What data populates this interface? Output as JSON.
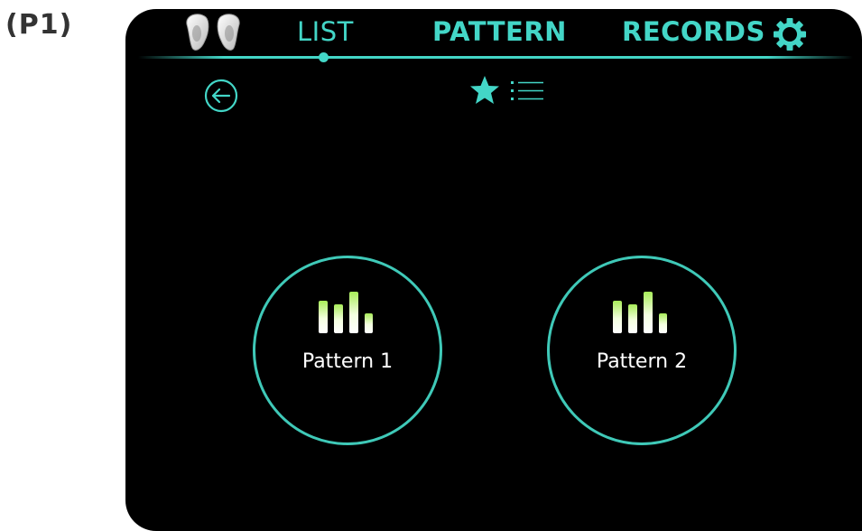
{
  "figure_label": "(P1)",
  "nav": {
    "items": [
      {
        "label": "LIST"
      },
      {
        "label": "PATTERN"
      },
      {
        "label": "RECORDS"
      }
    ],
    "active_index": 0
  },
  "icons": {
    "earbuds": "earbuds-icon",
    "settings": "gear-icon",
    "back": "back-arrow-icon",
    "favorites": "star-icon",
    "list": "list-icon",
    "pattern": "equalizer-bars-icon"
  },
  "patterns": [
    {
      "label": "Pattern 1"
    },
    {
      "label": "Pattern 2"
    }
  ],
  "colors": {
    "accent": "#43d6c7",
    "background": "#000000",
    "text": "#ffffff",
    "bar_top": "#b8f07a"
  }
}
